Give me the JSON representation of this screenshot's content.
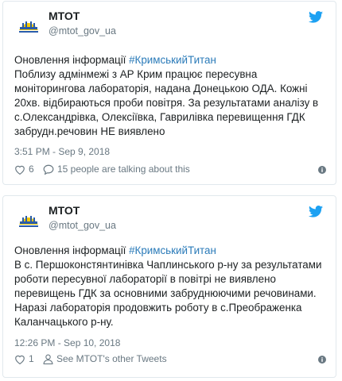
{
  "tweets": [
    {
      "author_name": "МТОТ",
      "handle": "@mtot_gov_ua",
      "body_prefix": "Оновлення інформації ",
      "hashtag": "#КримськийТитан",
      "body_rest": "\nПоблизу адмінмежі з АР Крим працює пересувна моніторингова лабораторія, надана Донецькою ОДА. Кожні 20хв. відбираються проби повітря. За результатами аналізу в с.Олександрівка, Олексіївка, Гаврилівка перевищення ГДК забрудн.речовин НЕ виявлено",
      "timestamp": "3:51 PM - Sep 9, 2018",
      "like_count": "6",
      "secondary_action": "15 people are talking about this"
    },
    {
      "author_name": "МТОТ",
      "handle": "@mtot_gov_ua",
      "body_prefix": "Оновлення інформації ",
      "hashtag": "#КримськийТитан",
      "body_rest": "\nВ с. Першоконстянтинівка Чаплинського р-ну за результатами роботи пересувної лабораторії в повітрі не виявлено перевищень ГДК за основними забруднюючими речовинами. Наразі лабораторія продовжить роботу в с.Преображенка Каланчацького р-ну.",
      "timestamp": "12:26 PM - Sep 10, 2018",
      "like_count": "1",
      "secondary_action": "See MTOT's other Tweets"
    }
  ],
  "icons": {
    "brand": "twitter-bird-icon",
    "like": "heart-icon",
    "reply": "speech-bubble-icon",
    "profile": "person-icon",
    "info": "info-icon"
  },
  "colors": {
    "brand_blue": "#1da1f2",
    "link": "#2b7bb9",
    "muted": "#697882",
    "border": "#e1e8ed"
  }
}
